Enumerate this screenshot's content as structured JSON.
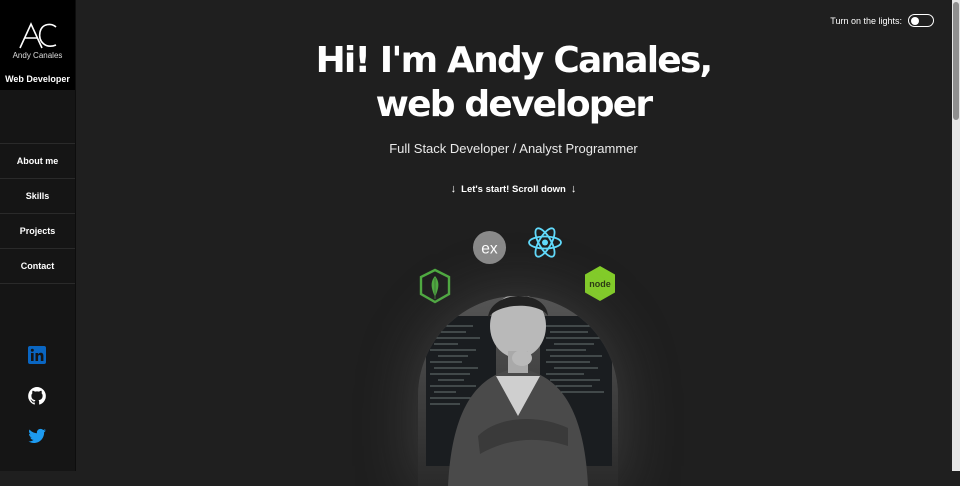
{
  "brand": {
    "logo_text": "AC",
    "name": "Andy Canales",
    "role": "Web Developer"
  },
  "nav": {
    "items": [
      {
        "label": "About me"
      },
      {
        "label": "Skills"
      },
      {
        "label": "Projects"
      },
      {
        "label": "Contact"
      }
    ]
  },
  "social": {
    "icons": [
      "linkedin-icon",
      "github-icon",
      "twitter-icon"
    ],
    "colors": {
      "linkedin": "#0a66c2",
      "github": "#ffffff",
      "twitter": "#1d9bf0"
    }
  },
  "lights": {
    "label": "Turn on the lights:",
    "enabled": false
  },
  "hero": {
    "title_line1": "Hi! I'm Andy Canales,",
    "title_line2": "web developer",
    "subtitle": "Full Stack Developer / Analyst Programmer",
    "scroll_cta": "Let's start! Scroll down",
    "cta_arrow": "↓"
  },
  "tech_icons": [
    {
      "name": "express",
      "label": "ex",
      "color": "#8a8a8a"
    },
    {
      "name": "react",
      "color": "#61dafb"
    },
    {
      "name": "mongodb",
      "color": "#4faa41"
    },
    {
      "name": "nodejs",
      "label": "node",
      "color": "#83cd29"
    }
  ],
  "colors": {
    "background": "#1f1f1f",
    "sidebar": "#151515",
    "brand_block": "#000000"
  }
}
